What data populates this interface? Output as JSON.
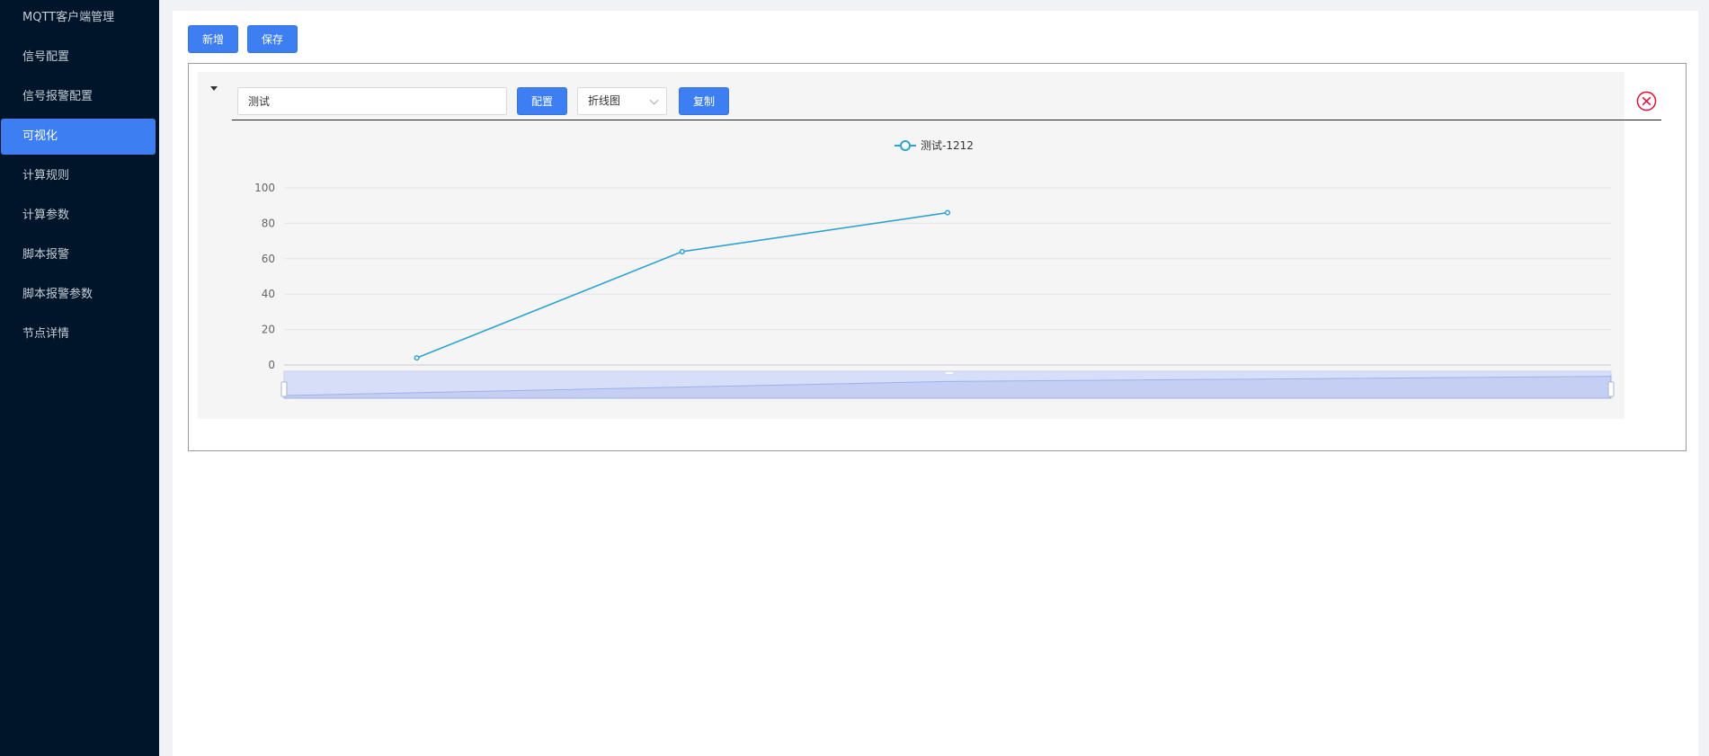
{
  "sidebar": {
    "items": [
      {
        "label": "MQTT客户端管理",
        "active": false
      },
      {
        "label": "信号配置",
        "active": false
      },
      {
        "label": "信号报警配置",
        "active": false
      },
      {
        "label": "可视化",
        "active": true
      },
      {
        "label": "计算规则",
        "active": false
      },
      {
        "label": "计算参数",
        "active": false
      },
      {
        "label": "脚本报警",
        "active": false
      },
      {
        "label": "脚本报警参数",
        "active": false
      },
      {
        "label": "节点详情",
        "active": false
      }
    ]
  },
  "toolbar": {
    "add_label": "新增",
    "save_label": "保存"
  },
  "card": {
    "name_value": "测试",
    "config_label": "配置",
    "chart_type_value": "折线图",
    "copy_label": "复制"
  },
  "colors": {
    "accent": "#3d7ff2",
    "sidebar_bg": "#001529",
    "series": "#2fa3cf",
    "close": "#e0103a",
    "zoom_fill": "#d6def8"
  },
  "icons": {
    "collapse": "caret-down-icon",
    "close": "close-circle-icon",
    "select": "chevron-down-icon"
  },
  "chart_data": {
    "type": "line",
    "series": [
      {
        "name": "测试-1212",
        "x": [
          1,
          2,
          3
        ],
        "values": [
          4,
          64,
          86
        ]
      }
    ],
    "xlim": [
      0.5,
      5.5
    ],
    "ylim": [
      0,
      100
    ],
    "yticks": [
      0,
      20,
      40,
      60,
      80,
      100
    ],
    "grid": true,
    "legend": "top-center",
    "datazoom": true
  }
}
